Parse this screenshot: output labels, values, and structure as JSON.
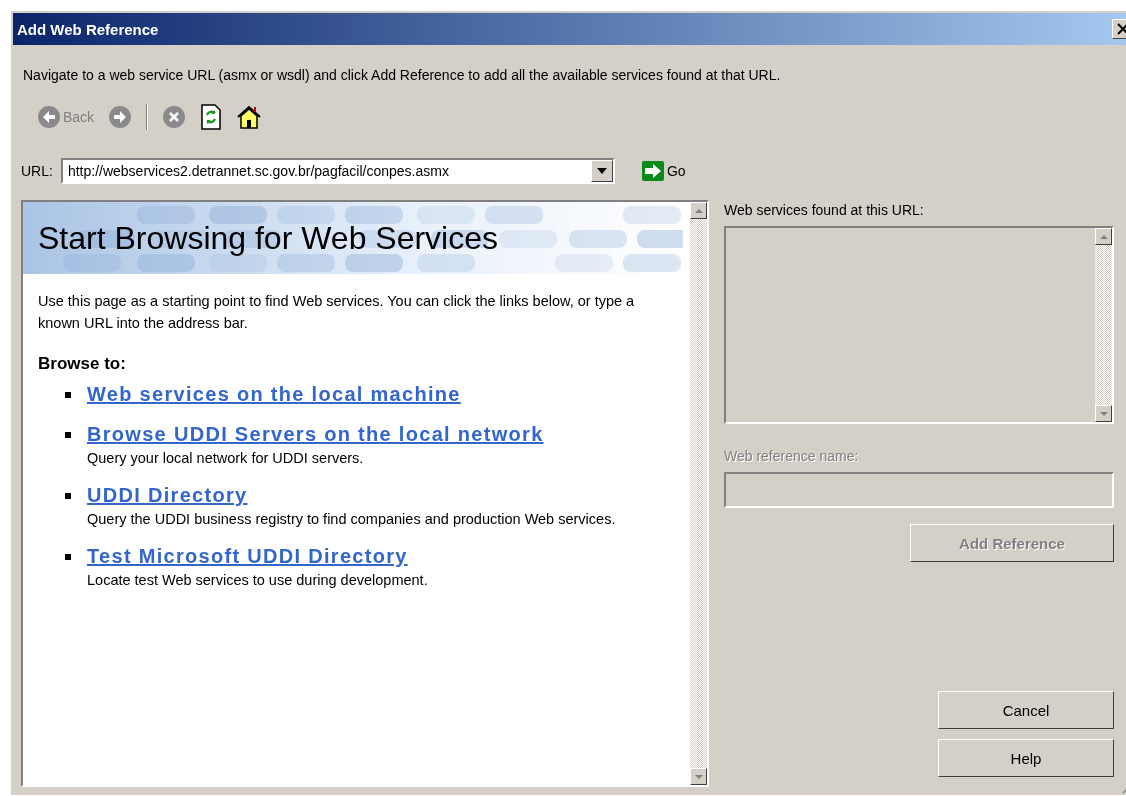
{
  "window": {
    "title": "Add Web Reference"
  },
  "instructions": "Navigate to a web service URL (asmx or wsdl) and click Add Reference to add all the available services found at that URL.",
  "toolbar": [
    {
      "kind": "back",
      "label": "Back",
      "disabled": true
    },
    {
      "kind": "forward",
      "disabled": true
    },
    {
      "kind": "separator"
    },
    {
      "kind": "stop",
      "disabled": true
    },
    {
      "kind": "refresh",
      "disabled": false
    },
    {
      "kind": "home",
      "disabled": false
    }
  ],
  "url": {
    "label": "URL:",
    "value": "http://webservices2.detrannet.sc.gov.br/pagfacil/conpes.asmx",
    "go": "Go"
  },
  "browser": {
    "heading": "Start Browsing for Web Services",
    "intro": "Use this page as a starting point to find Web services. You can click the links below, or type a known URL into the address bar.",
    "browse_label": "Browse to:",
    "links": [
      {
        "text": "Web services on the local machine"
      },
      {
        "text": "Browse UDDI Servers on the local network",
        "description": "Query your local network for UDDI servers."
      },
      {
        "text": "UDDI Directory",
        "description": "Query the UDDI business registry to find companies and production Web services."
      },
      {
        "text": "Test Microsoft UDDI Directory",
        "description": "Locate test Web services to use during development."
      }
    ]
  },
  "services": {
    "label": "Web services found at this URL:"
  },
  "reference_name": {
    "label": "Web reference name:",
    "disabled": true
  },
  "add_button": {
    "label": "Add Reference",
    "disabled": true
  },
  "buttons": [
    "Cancel",
    "Help"
  ]
}
